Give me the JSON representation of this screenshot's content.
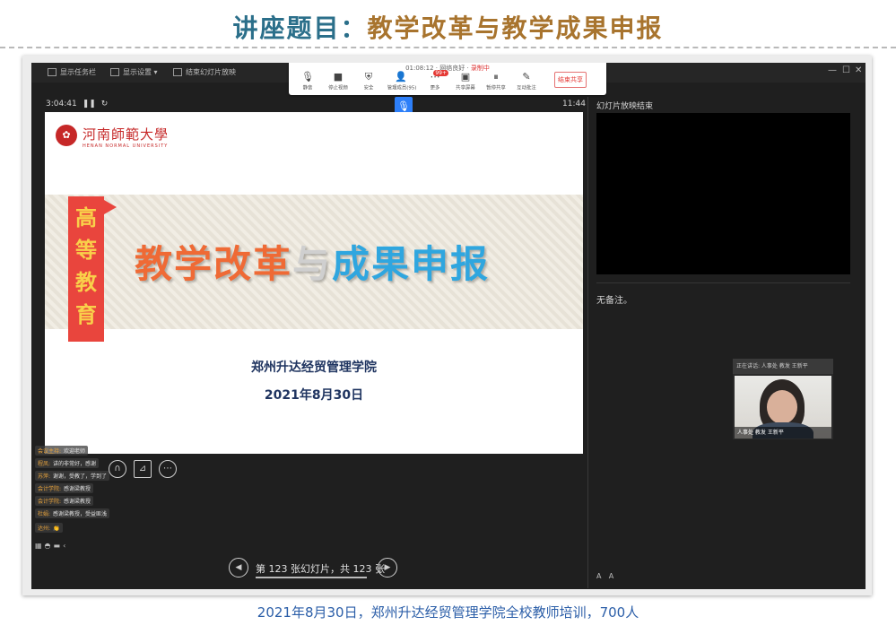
{
  "page": {
    "title_prefix": "讲座题目：",
    "title_main": "教学改革与教学成果申报",
    "caption": "2021年8月30日，郑州升达经贸管理学院全校教师培训，700人"
  },
  "presenter_toolbar": {
    "items": [
      "显示任务栏",
      "显示设置 ▾",
      "结束幻灯片放映"
    ]
  },
  "meeting_toolbar": {
    "timer_text": "01:08:12",
    "network_text": "网络良好",
    "recording_text": "录制中",
    "items": [
      {
        "label": "静音",
        "icon": "microphone-icon"
      },
      {
        "label": "停止视频",
        "icon": "camera-icon"
      },
      {
        "label": "安全",
        "icon": "shield-icon"
      },
      {
        "label": "管理成员(95)",
        "icon": "users-icon"
      },
      {
        "label": "更多",
        "icon": "more-icon",
        "badge": "99+"
      },
      {
        "label": "共享屏幕",
        "icon": "share-screen-icon"
      },
      {
        "label": "暂停共享",
        "icon": "pause-share-icon"
      },
      {
        "label": "互动批注",
        "icon": "annotate-icon"
      }
    ],
    "end_label": "结束共享"
  },
  "presenter": {
    "elapsed": "3:04:41",
    "clock": "11:44",
    "side_title": "幻灯片放映结束",
    "notes": "无备注。"
  },
  "slide": {
    "logo_cn": "河南師範大學",
    "logo_en": "HENAN NORMAL UNIVERSITY",
    "ribbon_text": "高等教育",
    "title_a": "教学改革",
    "title_b": "与",
    "title_c": "成果申报",
    "org": "郑州升达经贸管理学院",
    "date": "2021年8月30日"
  },
  "chat": [
    {
      "name": "会议主持:",
      "text": "欢迎老师"
    },
    {
      "name": "程凤:",
      "text": "讲的非常好，感谢"
    },
    {
      "name": "苏萍:",
      "text": "谢谢，受教了，学到了"
    },
    {
      "name": "会计学院:",
      "text": "感谢梁教授"
    },
    {
      "name": "会计学院:",
      "text": "感谢梁教授"
    },
    {
      "name": "杜娟:",
      "text": "感谢梁教授，受益匪浅"
    },
    {
      "name": "达州:",
      "text": "👏"
    }
  ],
  "slide_nav": {
    "label": "第 123 张幻灯片，共 123 张"
  },
  "video": {
    "header": "正在讲话: 人事处 教发 王新平",
    "name": "人事处 教发 王新平"
  }
}
